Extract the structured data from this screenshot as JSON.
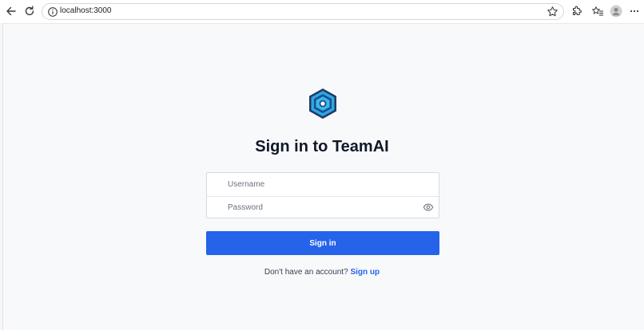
{
  "browser": {
    "url": "localhost:3000",
    "icons": {
      "back": "back-arrow-icon",
      "reload": "reload-icon",
      "info": "info-icon",
      "favorite": "star-icon",
      "extensions": "extensions-icon",
      "favorites": "favorites-icon",
      "profile": "profile-avatar-icon",
      "menu": "more-icon"
    }
  },
  "login": {
    "logo": "teamai-logo",
    "title": "Sign in to TeamAI",
    "username_placeholder": "Username",
    "password_placeholder": "Password",
    "password_toggle_icon": "eye-icon",
    "submit_label": "Sign in",
    "signup_prompt": "Don't have an account?",
    "signup_link": "Sign up"
  },
  "colors": {
    "accent": "#2563eb",
    "background": "#f8f9fb",
    "title": "#111827"
  }
}
